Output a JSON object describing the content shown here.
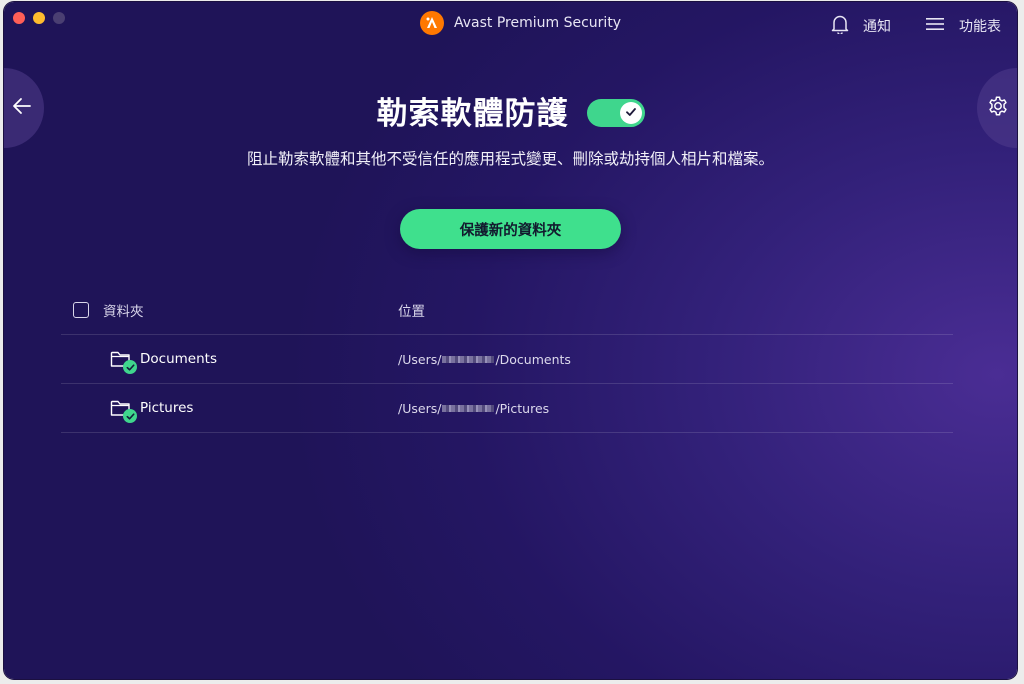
{
  "window": {
    "app_title": "Avast Premium Security"
  },
  "topbar": {
    "notifications_label": "通知",
    "menu_label": "功能表"
  },
  "icons": {
    "back": "arrow-left-icon",
    "settings": "gear-icon",
    "notifications": "bell-icon",
    "menu": "hamburger-icon",
    "folder": "folder-icon",
    "check": "check-icon"
  },
  "main": {
    "title": "勒索軟體防護",
    "toggle_on": true,
    "description": "阻止勒索軟體和其他不受信任的應用程式變更、刪除或劫持個人相片和檔案。",
    "primary_button": "保護新的資料夾"
  },
  "table": {
    "columns": [
      "資料夾",
      "位置"
    ],
    "rows": [
      {
        "name": "Documents",
        "path_prefix": "/Users/",
        "path_suffix": "/Documents"
      },
      {
        "name": "Pictures",
        "path_prefix": "/Users/",
        "path_suffix": "/Pictures"
      }
    ]
  },
  "colors": {
    "accent_green": "#3fe08d",
    "background": "#241663",
    "brand_orange": "#ff7800"
  }
}
